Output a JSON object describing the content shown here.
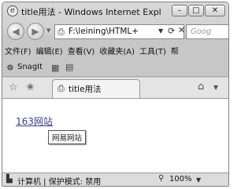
{
  "window": {
    "title": "title用法 - Windows Internet Explor...",
    "caption_minimize": "–",
    "caption_maximize": "□",
    "caption_close": "✕"
  },
  "nav": {
    "back_glyph": "◀",
    "forward_glyph": "▶",
    "address_value": "F:\\leining\\HTML+",
    "search_placeholder": "Goog"
  },
  "menu": {
    "items": [
      "文件(F)",
      "编辑(E)",
      "查看(V)",
      "收藏夹(A)",
      "工具(T)",
      "帮"
    ]
  },
  "toolbar": {
    "snagit_label": "SnagIt"
  },
  "tabs": {
    "active_label": "title用法"
  },
  "content": {
    "link_text": "163网站",
    "tooltip_text": "网易网站"
  },
  "status": {
    "zone_text": "计算机 | 保护模式: 禁用",
    "zoom_text": "100%"
  },
  "icons": {
    "page_icon": "ie-page-icon",
    "favorites": "star-icon",
    "home": "home-icon",
    "computer": "computer-icon"
  }
}
